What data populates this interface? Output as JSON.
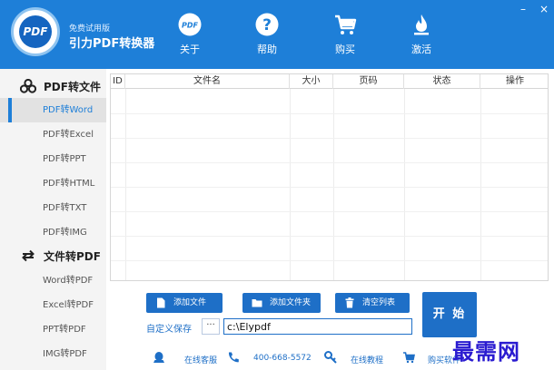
{
  "header": {
    "edition": "免费试用版",
    "title": "引力PDF转换器",
    "logo_text": "PDF",
    "nav": [
      {
        "label": "关于",
        "icon": "pdf-badge-icon"
      },
      {
        "label": "帮助",
        "icon": "question-icon"
      },
      {
        "label": "购买",
        "icon": "cart-icon"
      },
      {
        "label": "激活",
        "icon": "flame-icon"
      }
    ],
    "window_controls": {
      "minimize": "–",
      "close": "×"
    }
  },
  "sidebar": {
    "section1": {
      "label": "PDF转文件",
      "icon": "cluster-icon"
    },
    "pdf_items": [
      {
        "label": "PDF转Word"
      },
      {
        "label": "PDF转Excel"
      },
      {
        "label": "PDF转PPT"
      },
      {
        "label": "PDF转HTML"
      },
      {
        "label": "PDF转TXT"
      },
      {
        "label": "PDF转IMG"
      }
    ],
    "section2": {
      "label": "文件转PDF",
      "icon": "swap-icon"
    },
    "file_items": [
      {
        "label": "Word转PDF"
      },
      {
        "label": "Excel转PDF"
      },
      {
        "label": "PPT转PDF"
      },
      {
        "label": "IMG转PDF"
      }
    ]
  },
  "table": {
    "columns": [
      "ID",
      "文件名",
      "大小",
      "页码",
      "状态",
      "操作"
    ],
    "rows": []
  },
  "actions": {
    "add_file": "添加文件",
    "add_folder": "添加文件夹",
    "clear_list": "清空列表",
    "start": "开 始"
  },
  "save": {
    "label": "自定义保存",
    "browse": "···",
    "path": "c:\\Elypdf"
  },
  "footer": {
    "service": "在线客服",
    "phone": "400-668-5572",
    "tutorial": "在线教程",
    "buy": "购买软件"
  },
  "watermark": "最需网",
  "colors": {
    "accent": "#1e7fd8",
    "button": "#1e6fc7",
    "sidebar_bg": "#f4f4f4"
  }
}
